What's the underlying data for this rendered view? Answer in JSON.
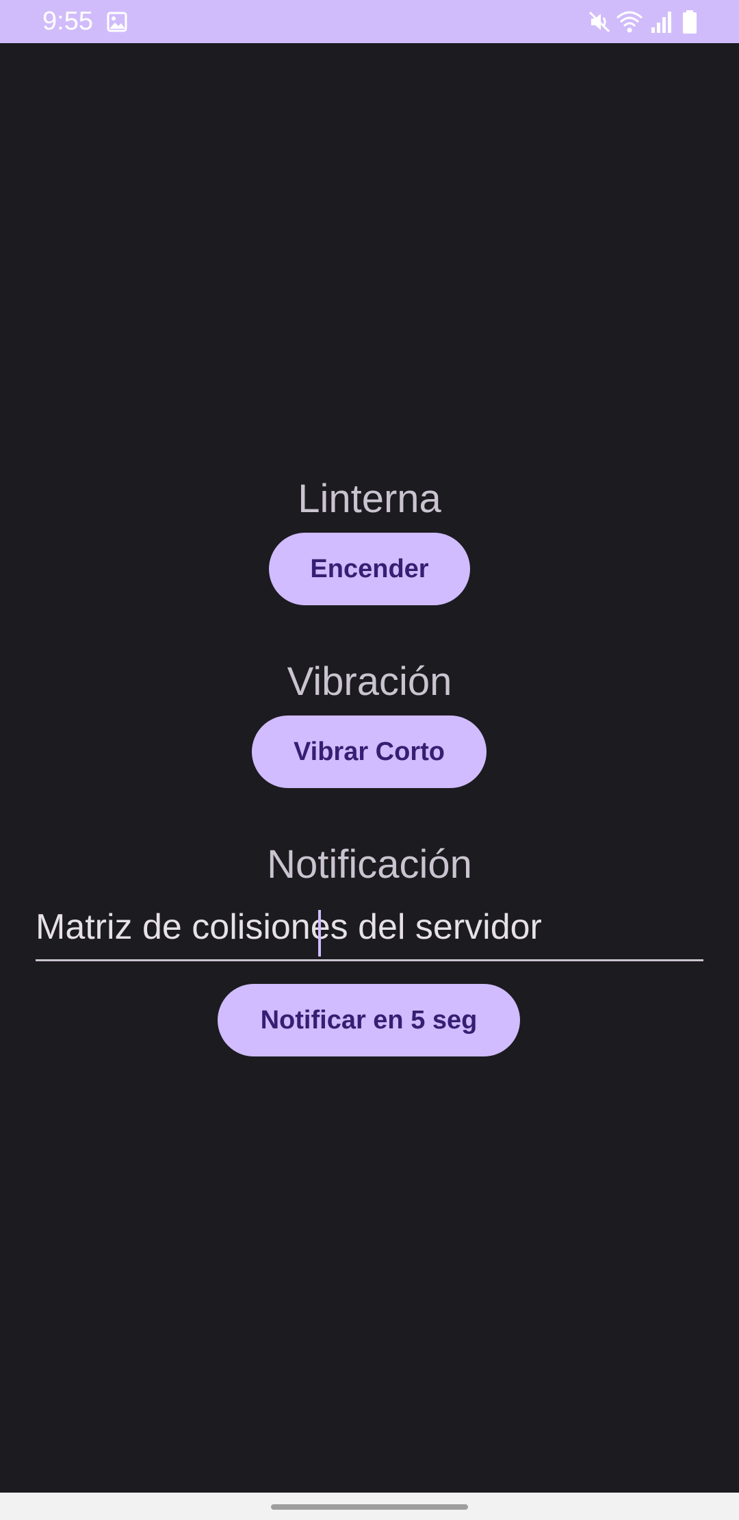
{
  "status_bar": {
    "time": "9:55",
    "icons": [
      "image-icon",
      "mute-icon",
      "wifi-icon",
      "signal-icon",
      "battery-icon"
    ]
  },
  "sections": {
    "flashlight": {
      "title": "Linterna",
      "button_label": "Encender"
    },
    "vibration": {
      "title": "Vibración",
      "button_label": "Vibrar Corto"
    },
    "notification": {
      "title": "Notificación",
      "input_value": "Matriz de colisiones del servidor",
      "button_label": "Notificar en 5 seg"
    }
  },
  "colors": {
    "status_bar": "#d1bcfb",
    "background": "#1c1b20",
    "button": "#d0bcfe",
    "button_text": "#381e72",
    "title_text": "#cac4d0"
  }
}
